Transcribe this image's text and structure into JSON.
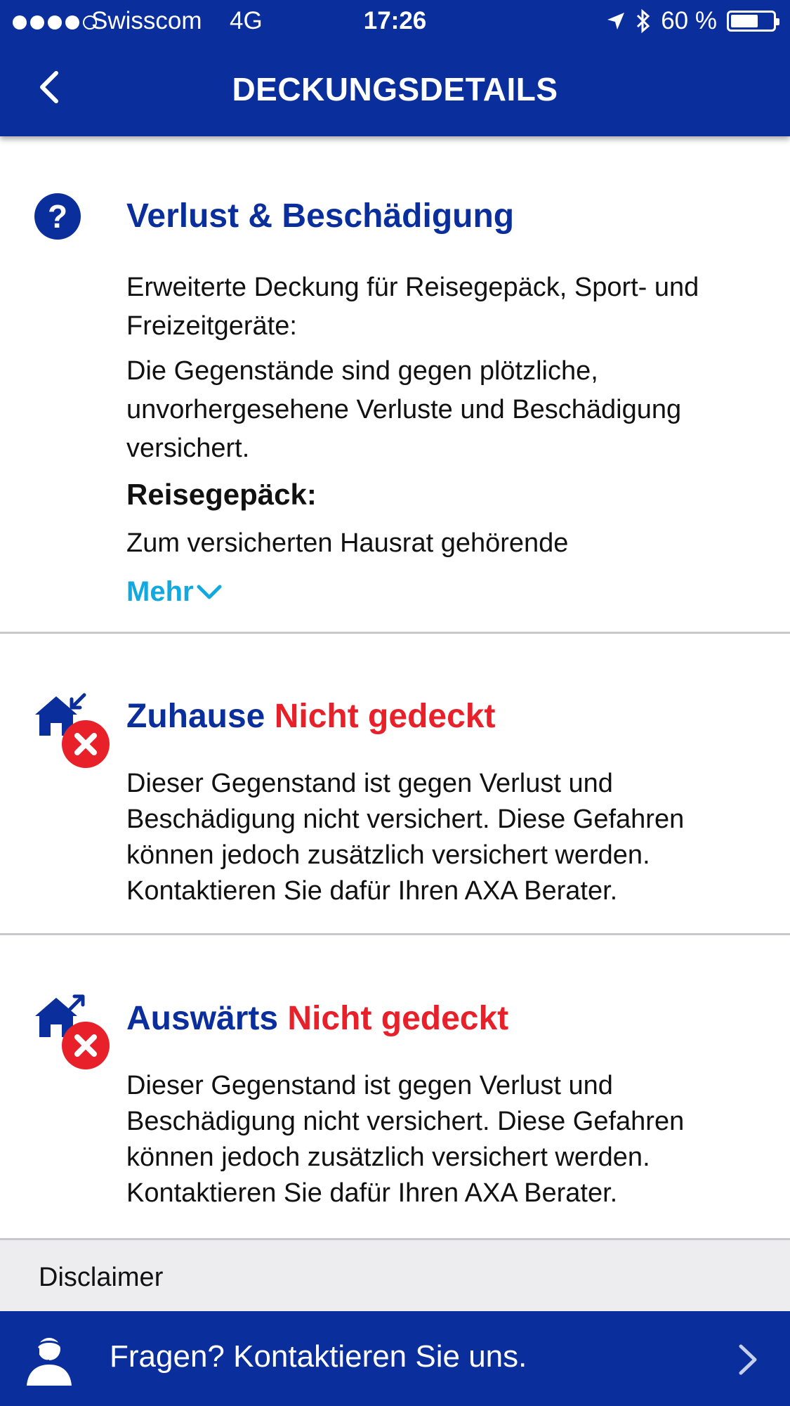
{
  "status_bar": {
    "carrier": "Swisscom",
    "network": "4G",
    "time": "17:26",
    "battery": "60 %"
  },
  "nav": {
    "title": "DECKUNGSDETAILS",
    "back_icon": "chevron-left-icon"
  },
  "colors": {
    "brand_blue": "#0a2f9c",
    "alert_red": "#e8202a",
    "link_blue": "#12a8e0"
  },
  "loss_section": {
    "icon": "question-icon",
    "title": "Verlust & Beschädigung",
    "intro": "Erweiterte Deckung für Reisegepäck, Sport- und Freizeitgeräte:",
    "body": "Die Gegenstände sind gegen plötzliche, unvorhergesehene Verluste und Beschädigung versichert.",
    "subheading": "Reisegepäck:",
    "truncated": "Zum versicherten Hausrat gehörende",
    "more_label": "Mehr"
  },
  "home_section": {
    "icon": "home-not-covered-icon",
    "title": "Zuhause",
    "status": "Nicht gedeckt",
    "body": "Dieser Gegenstand ist gegen Verlust und Beschädigung nicht versichert. Diese Gefahren können jedoch zusätzlich versichert werden. Kontaktieren Sie dafür Ihren AXA Berater."
  },
  "away_section": {
    "icon": "away-not-covered-icon",
    "title": "Auswärts",
    "status": "Nicht gedeckt",
    "body": "Dieser Gegenstand ist gegen Verlust und Beschädigung nicht versichert. Diese Gefahren können jedoch zusätzlich versichert werden. Kontaktieren Sie dafür Ihren AXA Berater."
  },
  "disclaimer": {
    "label": "Disclaimer"
  },
  "footer": {
    "label": "Fragen? Kontaktieren Sie uns."
  }
}
